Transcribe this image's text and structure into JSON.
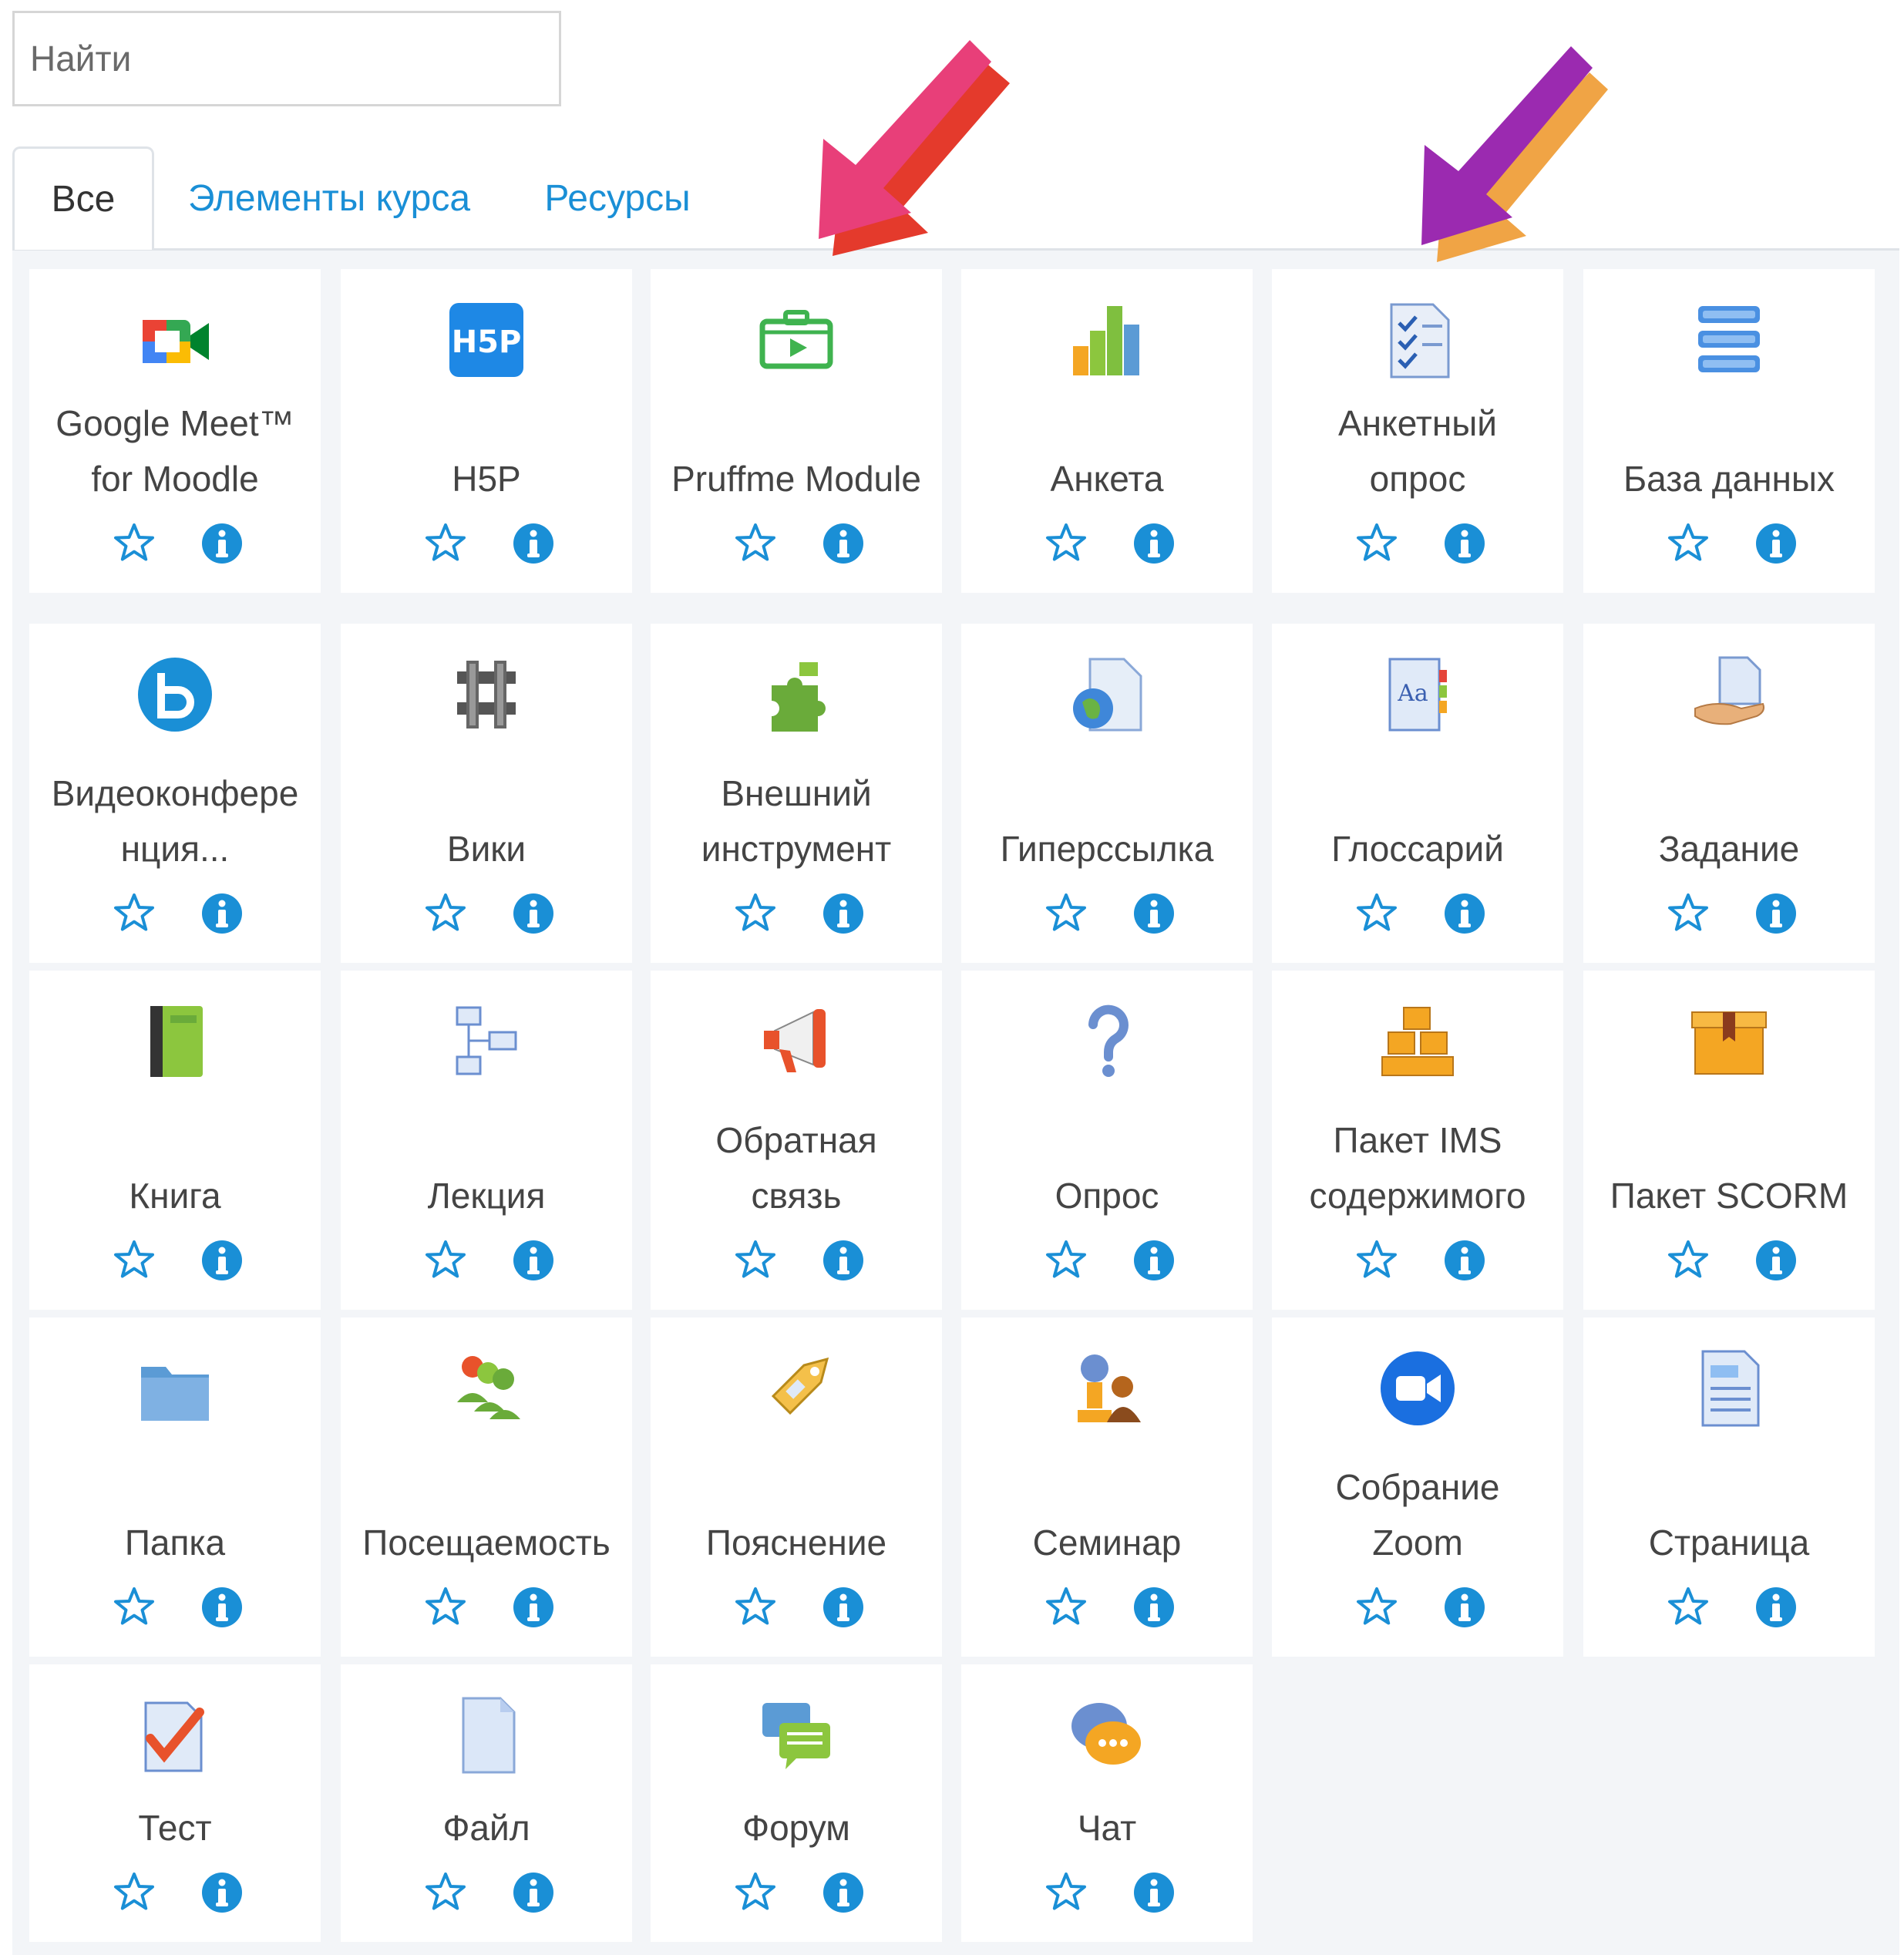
{
  "search": {
    "placeholder": "Найти",
    "value": ""
  },
  "tabs": [
    {
      "label": "Все",
      "active": true
    },
    {
      "label": "Элементы курса",
      "active": false
    },
    {
      "label": "Ресурсы",
      "active": false
    }
  ],
  "colors": {
    "link": "#1a8fd6",
    "arrow_pink": "#e83f79",
    "arrow_pink_shadow": "#e43a2c",
    "arrow_purple": "#9b2ab0",
    "arrow_purple_shadow": "#f0a445"
  },
  "activities": [
    {
      "lines": [
        "Google Meet™",
        "for Moodle"
      ],
      "icon": "google-meet-icon"
    },
    {
      "lines": [
        "H5P"
      ],
      "icon": "h5p-icon"
    },
    {
      "lines": [
        "Pruffme Module"
      ],
      "icon": "pruffme-icon"
    },
    {
      "lines": [
        "Анкета"
      ],
      "icon": "bar-chart-icon"
    },
    {
      "lines": [
        "Анкетный",
        "опрос"
      ],
      "icon": "checklist-icon"
    },
    {
      "lines": [
        "База данных"
      ],
      "icon": "database-icon"
    },
    {
      "lines": [
        "Видеоконфере",
        "нция..."
      ],
      "icon": "bigbluebutton-icon"
    },
    {
      "lines": [
        "Вики"
      ],
      "icon": "wiki-icon"
    },
    {
      "lines": [
        "Внешний",
        "инструмент"
      ],
      "icon": "puzzle-icon"
    },
    {
      "lines": [
        "Гиперссылка"
      ],
      "icon": "globe-document-icon"
    },
    {
      "lines": [
        "Глоссарий"
      ],
      "icon": "glossary-icon"
    },
    {
      "lines": [
        "Задание"
      ],
      "icon": "hand-document-icon"
    },
    {
      "lines": [
        "Книга"
      ],
      "icon": "book-icon"
    },
    {
      "lines": [
        "Лекция"
      ],
      "icon": "flowchart-icon"
    },
    {
      "lines": [
        "Обратная",
        "связь"
      ],
      "icon": "megaphone-icon"
    },
    {
      "lines": [
        "Опрос"
      ],
      "icon": "question-icon"
    },
    {
      "lines": [
        "Пакет IMS",
        "содержимого"
      ],
      "icon": "boxes-icon"
    },
    {
      "lines": [
        "Пакет SCORM"
      ],
      "icon": "box-icon"
    },
    {
      "lines": [
        "Папка"
      ],
      "icon": "folder-icon"
    },
    {
      "lines": [
        "Посещаемость"
      ],
      "icon": "people-icon"
    },
    {
      "lines": [
        "Пояснение"
      ],
      "icon": "tag-icon"
    },
    {
      "lines": [
        "Семинар"
      ],
      "icon": "seminar-icon"
    },
    {
      "lines": [
        "Собрание",
        "Zoom"
      ],
      "icon": "zoom-icon"
    },
    {
      "lines": [
        "Страница"
      ],
      "icon": "page-icon"
    },
    {
      "lines": [
        "Тест"
      ],
      "icon": "quiz-icon"
    },
    {
      "lines": [
        "Файл"
      ],
      "icon": "file-icon"
    },
    {
      "lines": [
        "Форум"
      ],
      "icon": "forum-icon"
    },
    {
      "lines": [
        "Чат"
      ],
      "icon": "chat-icon"
    }
  ]
}
